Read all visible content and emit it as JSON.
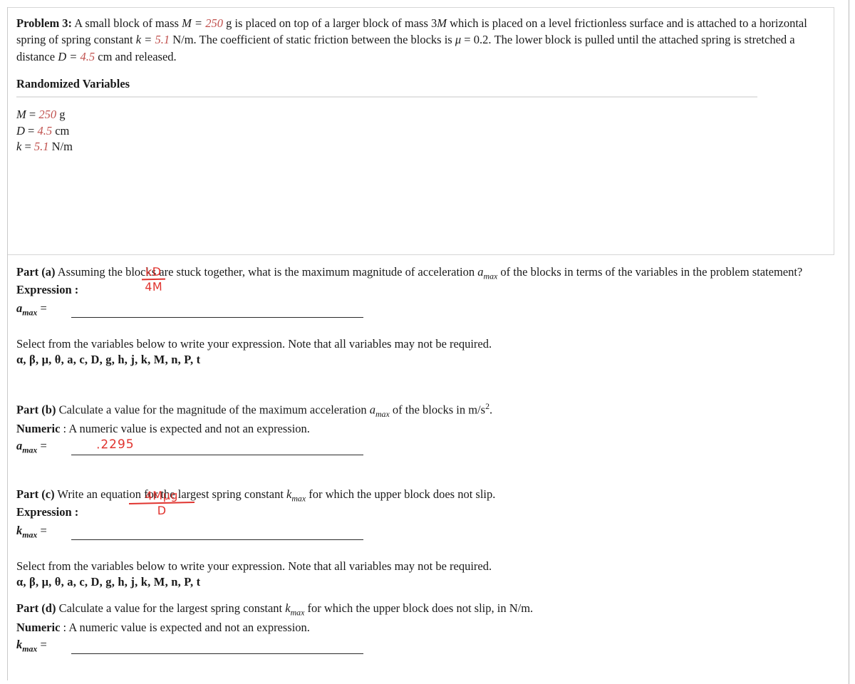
{
  "problem": {
    "label": "Problem 3:",
    "statement_parts": [
      "A small block of mass ",
      " is placed on top of a larger block of mass 3",
      " which is placed on a level frictionless surface and is attached to a horizontal spring of spring constant ",
      " N/m. The coefficient of static friction between the blocks is ",
      " = 0.2. The lower block is pulled until the attached spring is stretched a distance ",
      " cm and released."
    ],
    "stem_sym_M": "M =",
    "stem_val_M": "250",
    "stem_unit_M": "g",
    "stem_sym_M2": "M",
    "stem_sym_k": "k =",
    "stem_val_k": "5.1",
    "stem_sym_mu": "μ",
    "stem_sym_D": "D =",
    "stem_val_D": "4.5"
  },
  "randomized": {
    "title": "Randomized Variables",
    "rows": [
      {
        "symbol": "M",
        "eq": "=",
        "value": "250",
        "unit": "g"
      },
      {
        "symbol": "D",
        "eq": "=",
        "value": "4.5",
        "unit": "cm"
      },
      {
        "symbol": "k",
        "eq": "=",
        "value": "5.1",
        "unit": "N/m"
      }
    ]
  },
  "variable_prompt": "Select from the variables below to write your expression. Note that all variables may not be required.",
  "variable_list": "α, β, μ, θ, a, c, D, g, h, j, k, M, n, P, t",
  "parts": {
    "a": {
      "label": "Part (a)",
      "text_1": "Assuming the blocks are stuck together, what is the maximum magnitude of acceleration ",
      "sym": "a",
      "sub": "max",
      "text_2": " of the blocks in terms of the variables in the problem statement?",
      "kind": "Expression",
      "kind_sep": ":",
      "answer_var": "a",
      "answer_sub": "max",
      "answer_eq": "=",
      "handwriting": {
        "type": "fraction",
        "numerator": "kD",
        "denominator": "4M"
      }
    },
    "b": {
      "label": "Part (b)",
      "text_1": "Calculate a value for the magnitude of the maximum acceleration ",
      "sym": "a",
      "sub": "max",
      "text_2": " of the blocks in m/s",
      "text_2_sup": "2",
      "text_3": ".",
      "kind": "Numeric",
      "kind_sep": ": A numeric value is expected and not an expression.",
      "answer_var": "a",
      "answer_sub": "max",
      "answer_eq": "=",
      "handwriting": {
        "type": "value",
        "value": ".2295"
      }
    },
    "c": {
      "label": "Part (c)",
      "text_1": "Write an equation for the largest spring constant ",
      "sym": "k",
      "sub": "max",
      "text_2": " for which the upper block does not slip.",
      "kind": "Expression",
      "kind_sep": ":",
      "answer_var": "k",
      "answer_sub": "max",
      "answer_eq": "=",
      "handwriting": {
        "type": "fraction",
        "numerator": "4Mμg",
        "denominator": "D"
      }
    },
    "d": {
      "label": "Part (d)",
      "text_1": "Calculate a value for the largest spring constant ",
      "sym": "k",
      "sub": "max",
      "text_2": " for which the upper block does not slip, in N/m.",
      "kind": "Numeric",
      "kind_sep": ": A numeric value is expected and not an expression.",
      "answer_var": "k",
      "answer_sub": "max",
      "answer_eq": "=",
      "handwriting": null
    }
  },
  "colors": {
    "randomized_value": "#c0504d",
    "handwriting": "#e0342f",
    "rule": "#2b2b2b",
    "border": "#d6d6d6"
  }
}
